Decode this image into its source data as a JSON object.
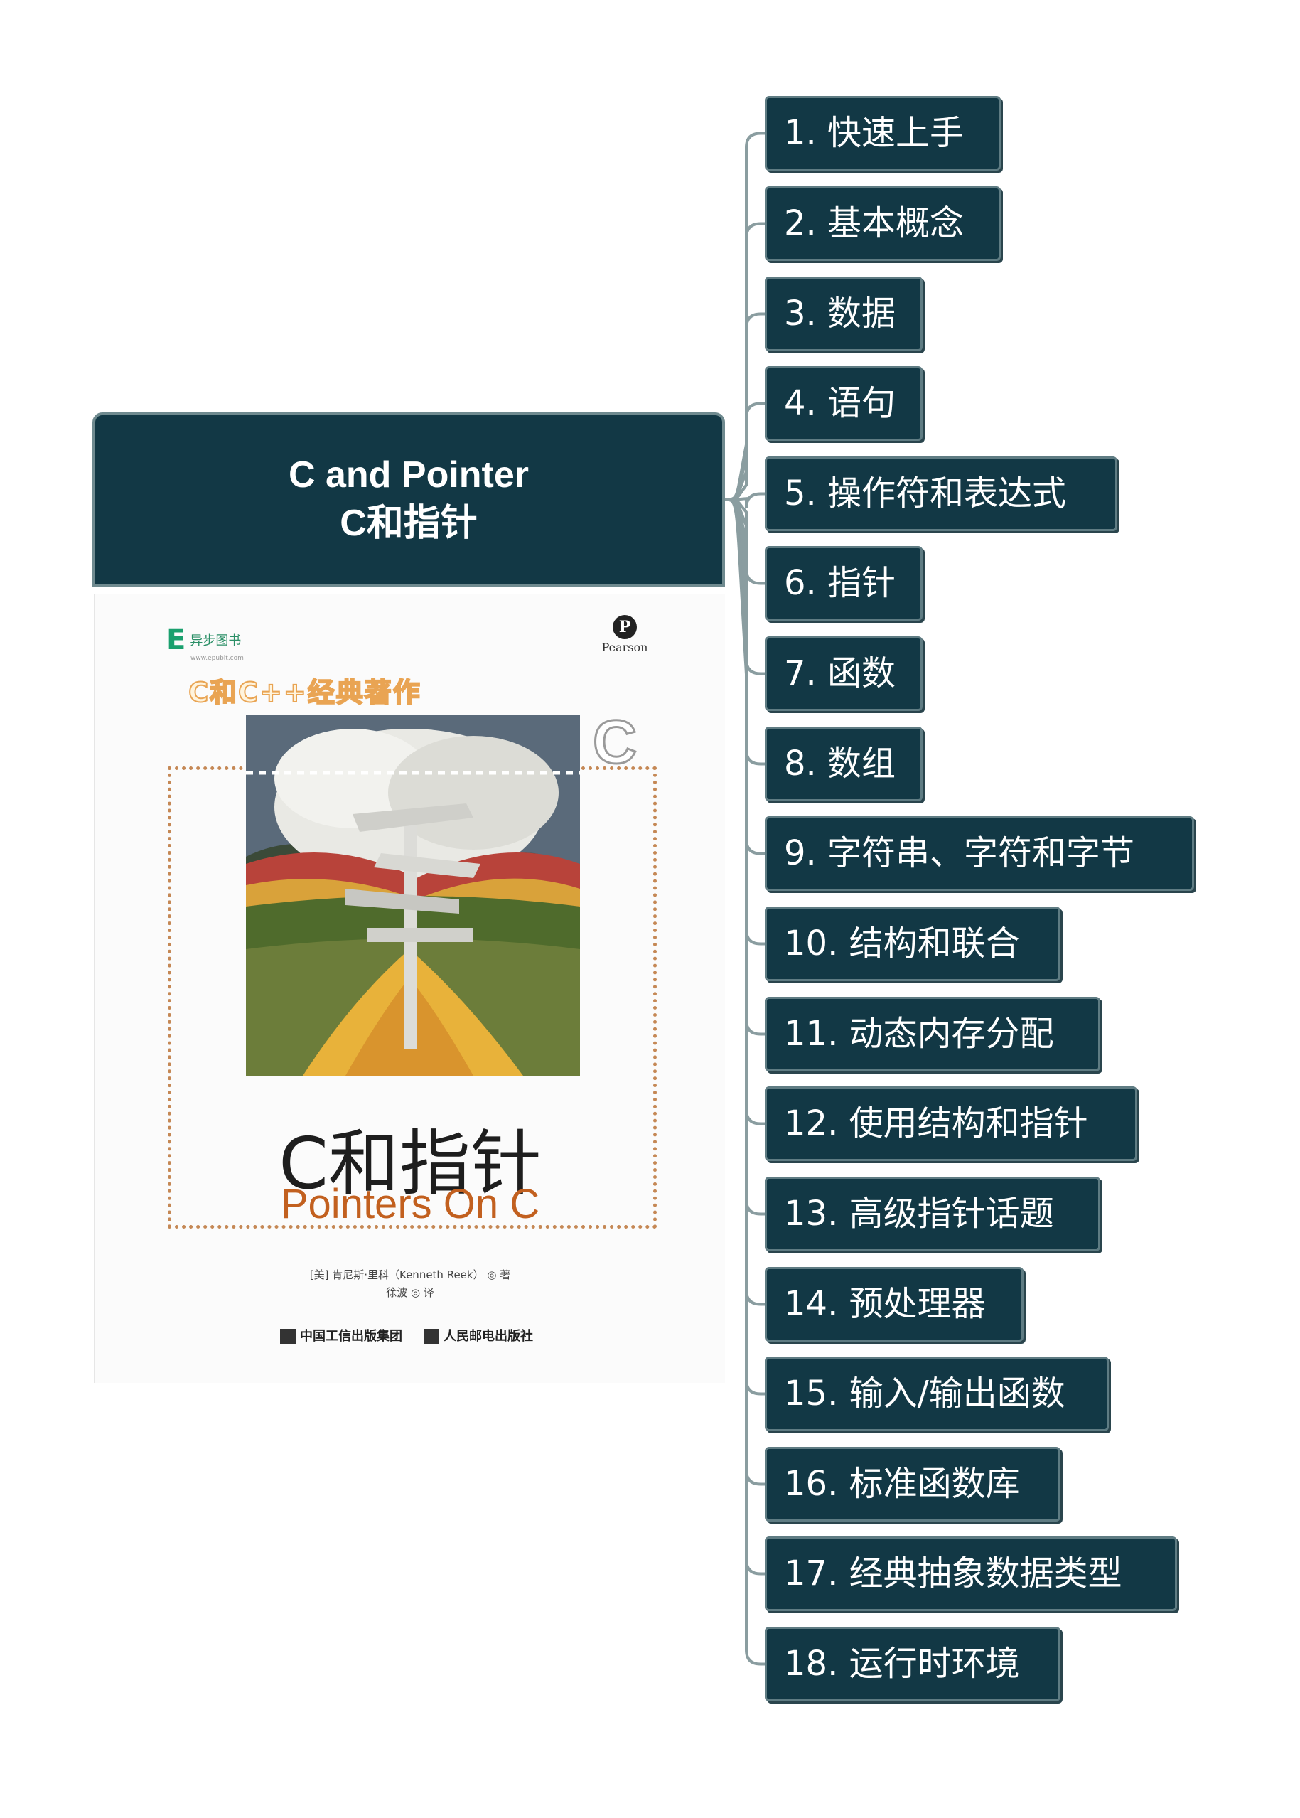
{
  "root": {
    "title_en": "C and Pointer",
    "title_cn": "C和指针"
  },
  "cover": {
    "publisher_logo": "异步图书",
    "publisher_logo_sub": "www.epubit.com",
    "pearson": "Pearson",
    "series": "C和C++经典著作",
    "title_cn": "C和指针",
    "title_en": "Pointers On C",
    "author": "[美] 肯尼斯·里科（Kenneth Reek） ◎ 著",
    "translator": "徐波 ◎ 译",
    "publisher_1": "中国工信出版集团",
    "publisher_2": "人民邮电出版社"
  },
  "topics": [
    "1. 快速上手",
    "2. 基本概念",
    "3. 数据",
    "4. 语句",
    "5. 操作符和表达式",
    "6. 指针",
    "7. 函数",
    "8. 数组",
    "9. 字符串、字符和字节",
    "10. 结构和联合",
    "11. 动态内存分配",
    "12. 使用结构和指针",
    "13. 高级指针话题",
    "14. 预处理器",
    "15. 输入/输出函数",
    "16. 标准函数库",
    "17. 经典抽象数据类型",
    "18. 运行时环境"
  ],
  "colors": {
    "node_fill": "#123845",
    "node_border": "#5f7c83",
    "connector": "#8a9da0"
  }
}
